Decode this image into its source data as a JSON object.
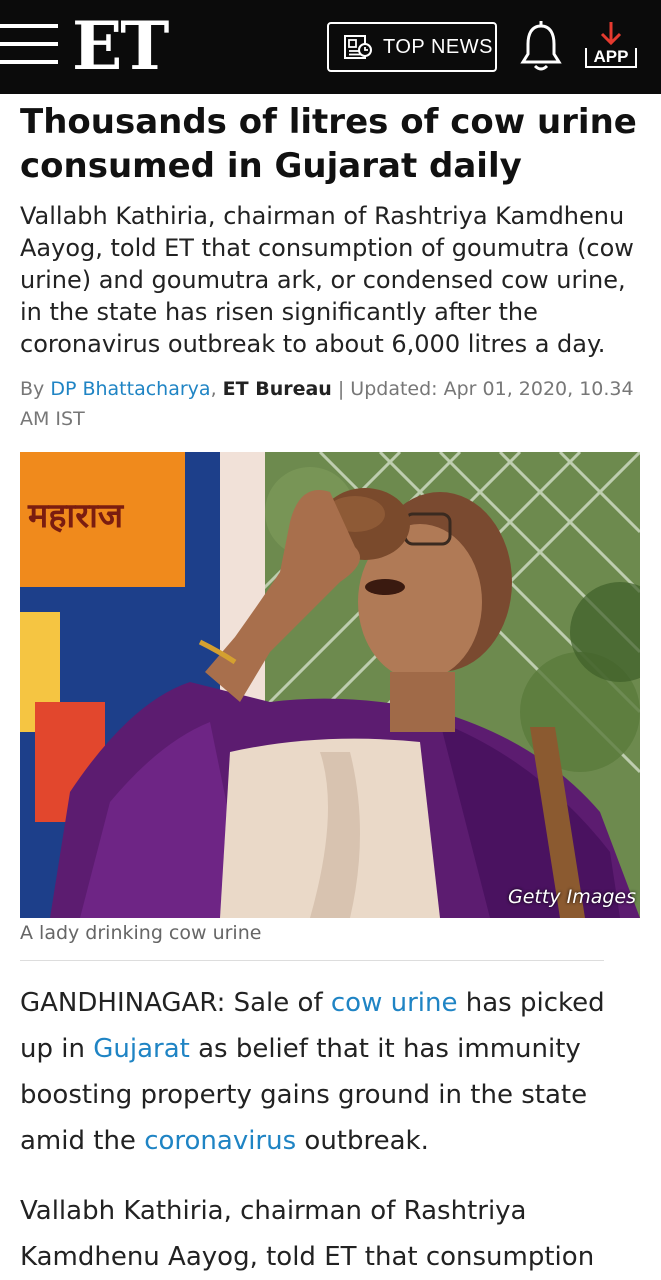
{
  "header": {
    "logo": "ET",
    "top_news_label": "TOP NEWS",
    "app_label": "APP",
    "icons": [
      "menu-icon",
      "newspaper-icon",
      "bell-icon",
      "download-arrow-icon"
    ]
  },
  "article": {
    "headline": "Thousands of litres of cow urine consumed in Gujarat daily",
    "summary": "Vallabh Kathiria, chairman of Rashtriya Kamdhenu Aayog, told ET that consumption of goumutra (cow urine) and goumutra ark, or condensed cow urine, in the state has risen significantly after the coronavirus outbreak to about 6,000 litres a day.",
    "byline": {
      "prefix": "By ",
      "author": "DP Bhattacharya",
      "sep": ", ",
      "bureau": "ET Bureau",
      "updated": " | Updated: Apr 01, 2020, 10.34 AM IST"
    },
    "image": {
      "credit": "Getty Images",
      "banner_text": "महाराज",
      "caption": "A lady drinking cow urine"
    },
    "body": {
      "p1": {
        "t1": "GANDHINAGAR: Sale of ",
        "k1": "cow urine",
        "t2": " has picked up in ",
        "k2": "Gujarat",
        "t3": " as belief that it has immunity boosting property gains ground in the state amid the ",
        "k3": "coronavirus",
        "t4": " outbreak."
      },
      "p2": "Vallabh Kathiria, chairman of Rashtriya Kamdhenu Aayog, told ET that consumption"
    }
  },
  "colors": {
    "header_bg": "#0b0b0b",
    "link": "#1f84c4",
    "app_arrow": "#e53a2f"
  }
}
